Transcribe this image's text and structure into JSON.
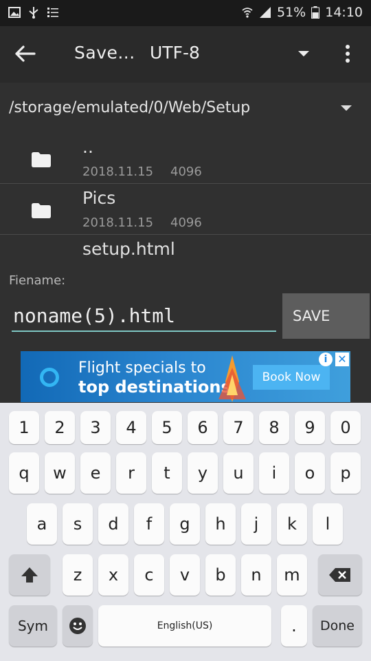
{
  "status_bar": {
    "battery": "51%",
    "time": "14:10",
    "left_icons": [
      "image-icon",
      "usb-icon",
      "list-icon"
    ],
    "right_icons": [
      "wifi-icon",
      "signal-icon",
      "battery-icon"
    ]
  },
  "toolbar": {
    "title": "Save...",
    "encoding": "UTF-8"
  },
  "path": "/storage/emulated/0/Web/Setup",
  "files": [
    {
      "name": "..",
      "date": "2018.11.15",
      "size": "4096",
      "type": "folder"
    },
    {
      "name": "Pics",
      "date": "2018.11.15",
      "size": "4096",
      "type": "folder"
    },
    {
      "name": "setup.html",
      "type": "file"
    }
  ],
  "filename": {
    "label": "Fiename:",
    "value": "noname(5).html"
  },
  "save_label": "SAVE",
  "ad": {
    "line1": "Flight specials to",
    "line2": "top destinations",
    "button": "Book Now",
    "info": "i",
    "close": "✕"
  },
  "keyboard": {
    "row1": [
      "1",
      "2",
      "3",
      "4",
      "5",
      "6",
      "7",
      "8",
      "9",
      "0"
    ],
    "row2": [
      "q",
      "w",
      "e",
      "r",
      "t",
      "y",
      "u",
      "i",
      "o",
      "p"
    ],
    "row3": [
      "a",
      "s",
      "d",
      "f",
      "g",
      "h",
      "j",
      "k",
      "l"
    ],
    "row4": [
      "z",
      "x",
      "c",
      "v",
      "b",
      "n",
      "m"
    ],
    "sym": "Sym",
    "space": "English(US)",
    "period": ".",
    "done": "Done"
  },
  "colors": {
    "accent": "#7fc7c4",
    "background": "#303030",
    "toolbar": "#2a2a2a"
  }
}
